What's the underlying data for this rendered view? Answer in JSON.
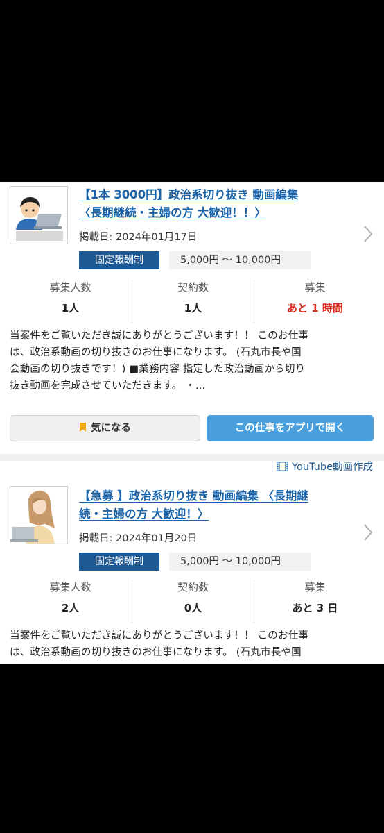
{
  "listings": [
    {
      "title_line1": "【1本 3000円】政治系切り抜き 動画編集",
      "title_line2": "〈長期継続・主婦の方 大歓迎！！〉",
      "posted": "掲載日: 2024年01月17日",
      "pay_type": "固定報酬制",
      "price_range": "5,000円 ～ 10,000円",
      "stats": [
        {
          "label": "募集人数",
          "value": "1人"
        },
        {
          "label": "契約数",
          "value": "1人"
        },
        {
          "label": "募集",
          "value": "あと 1 時間"
        }
      ],
      "description": [
        "当案件をご覧いただき誠にありがとうございます！！ このお仕事",
        "は、政治系動画の切り抜きのお仕事になります。 (石丸市長や国",
        "会動画の切り抜きです！) ■業務内容 指定した政治動画から切り",
        "抜き動画を完成させていただきます。 ・..."
      ],
      "fav_label": "気になる",
      "app_label": "この仕事をアプリで開く",
      "category": "YouTube動画作成"
    },
    {
      "title_line1": "【急募 】政治系切り抜き 動画編集 〈長期継",
      "title_line2": "続・主婦の方 大歓迎！〉",
      "posted": "掲載日: 2024年01月20日",
      "pay_type": "固定報酬制",
      "price_range": "5,000円 ～ 10,000円",
      "stats": [
        {
          "label": "募集人数",
          "value": "2人"
        },
        {
          "label": "契約数",
          "value": "0人"
        },
        {
          "label": "募集",
          "value": "あと 3 日"
        }
      ],
      "description": [
        "当案件をご覧いただき誠にありがとうございます！！ このお仕事",
        "は、政治系動画の切り抜きのお仕事になります。 (石丸市長や国"
      ]
    }
  ],
  "colors": {
    "link": "#1a63a8",
    "badge": "#1d5a95",
    "primary_button": "#4a9fdc",
    "urgent": "#d92d20",
    "bookmark": "#f0a81c"
  },
  "icons": {
    "chevron": "chevron-right-icon",
    "bookmark": "bookmark-icon",
    "category": "film-icon"
  }
}
